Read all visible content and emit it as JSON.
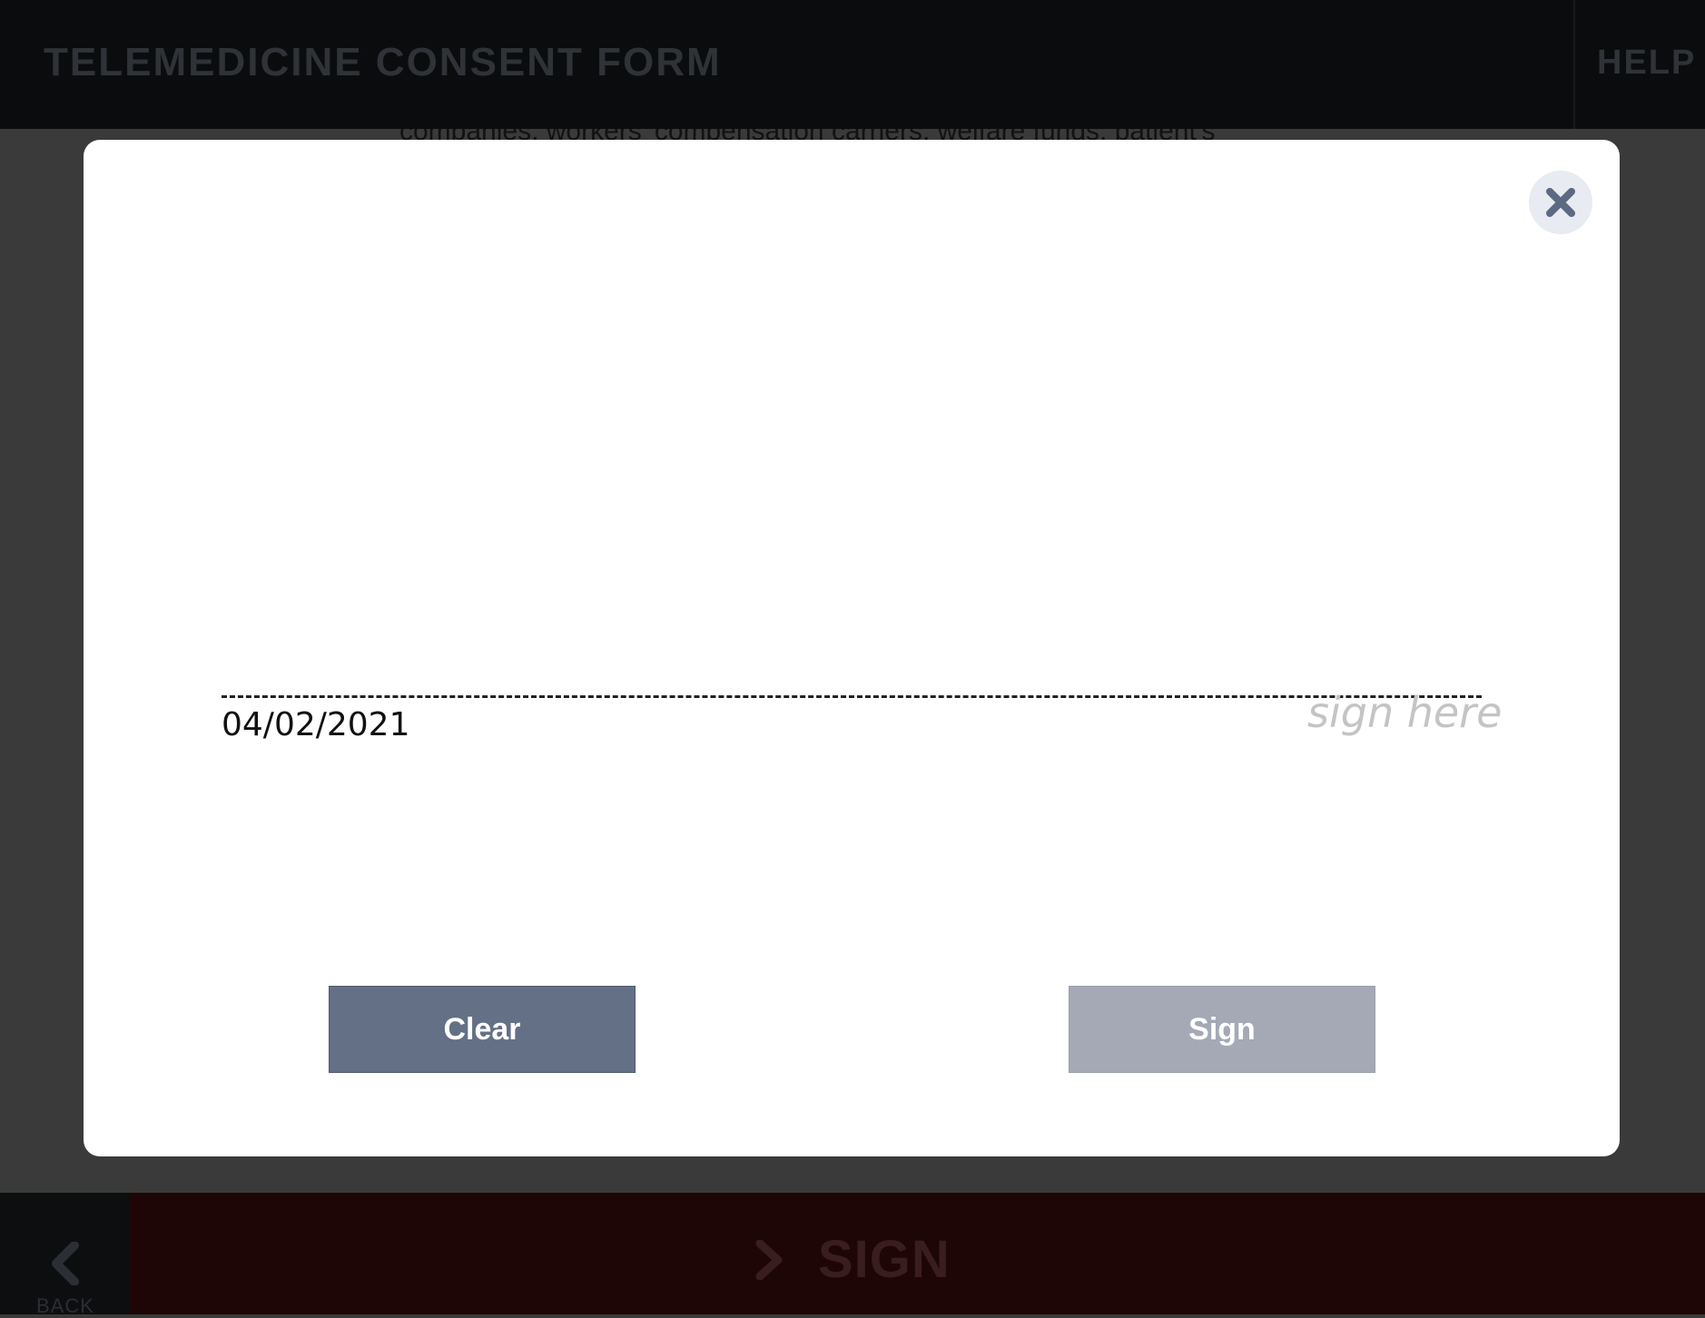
{
  "header": {
    "title": "TELEMEDICINE CONSENT FORM",
    "help_label": "HELP"
  },
  "background_doc": {
    "visible_text": "companies, workers' compensation carriers, welfare funds, patient's"
  },
  "modal": {
    "date": "04/02/2021",
    "sign_hint": "sign here",
    "clear_label": "Clear",
    "sign_label": "Sign"
  },
  "footer": {
    "back_label": "BACK",
    "sign_label": "SIGN"
  },
  "colors": {
    "header_bg": "#0b0c0e",
    "overlay": "#3a3a3a",
    "clear_button": "#647086",
    "sign_button_disabled": "#a4a9b5",
    "footer_sign_bar": "#1e0606"
  },
  "icons": {
    "close": "close-icon",
    "back": "chevron-left-icon",
    "sign": "chevron-right-icon"
  }
}
